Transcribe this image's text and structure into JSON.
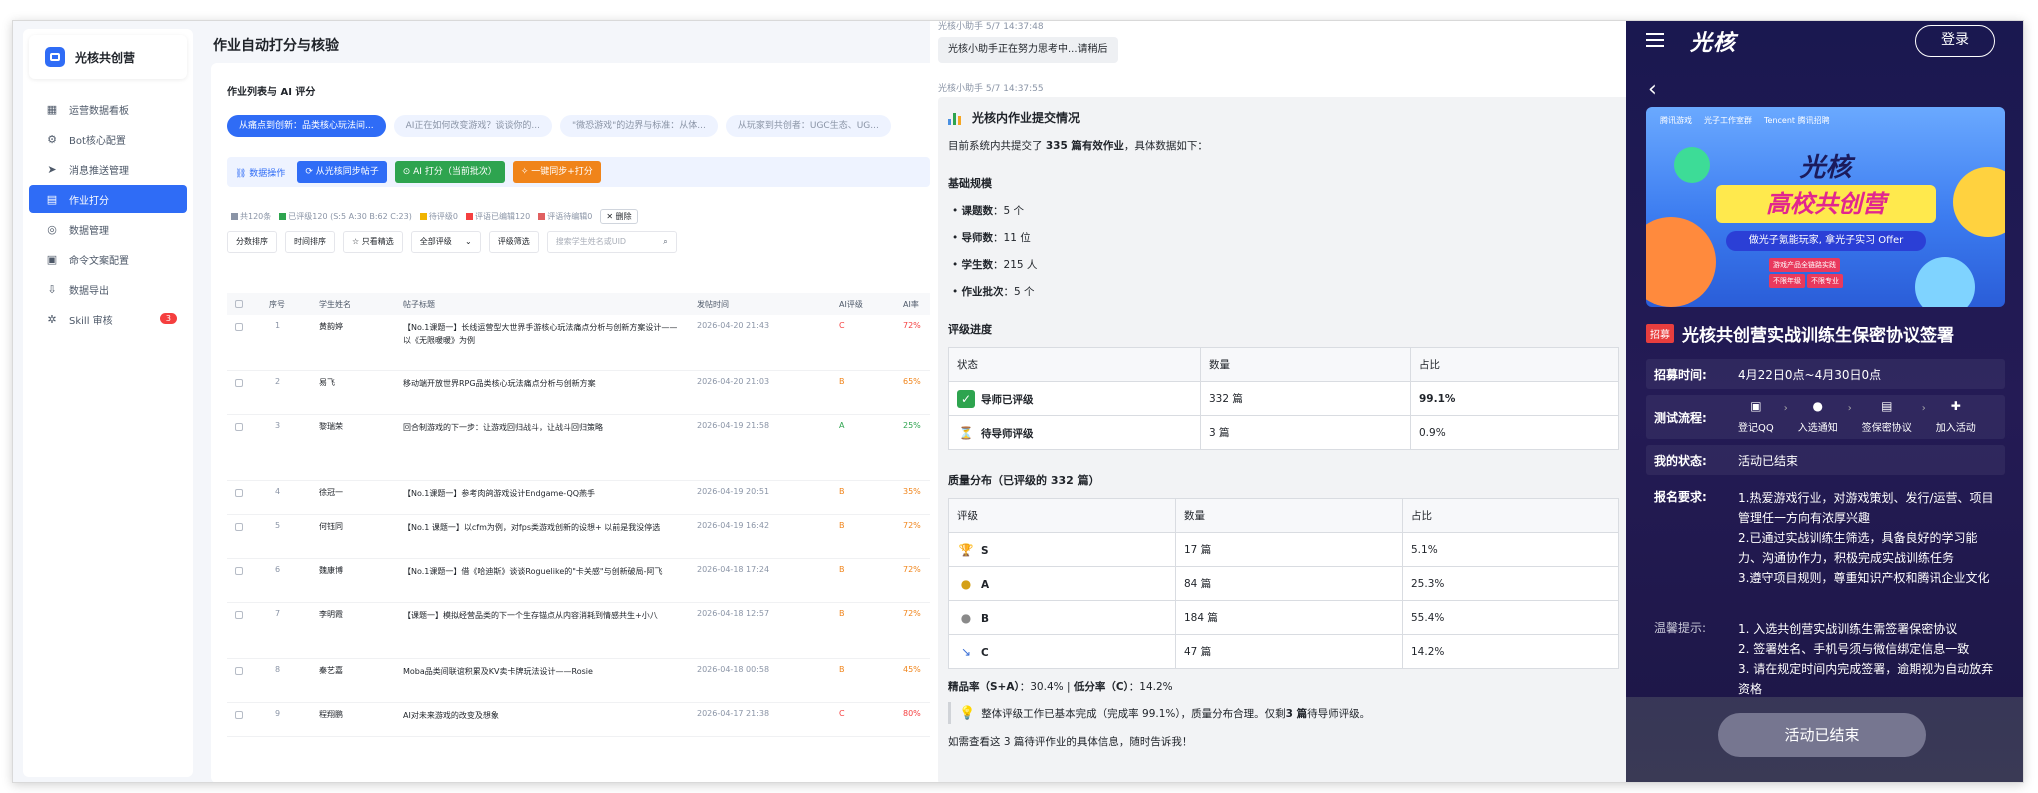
{
  "sidebar": {
    "brand": "光核共创营",
    "items": [
      {
        "label": "运营数据看板",
        "icon": "dashboard-icon"
      },
      {
        "label": "Bot核心配置",
        "icon": "gear-icon"
      },
      {
        "label": "消息推送管理",
        "icon": "send-icon"
      },
      {
        "label": "作业打分",
        "icon": "document-icon",
        "active": true
      },
      {
        "label": "数据管理",
        "icon": "database-icon"
      },
      {
        "label": "命令文案配置",
        "icon": "command-doc-icon"
      },
      {
        "label": "数据导出",
        "icon": "download-icon"
      },
      {
        "label": "Skill 审核",
        "icon": "skill-icon",
        "badge": "3"
      }
    ]
  },
  "main": {
    "page_title": "作业自动打分与核验",
    "card_title": "作业列表与 AI 评分",
    "chips": [
      "从痛点到创新：品类核心玩法间...",
      "AI正在如何改变游戏？谈谈你的...",
      "\"微恐游戏\"的边界与标准：从体...",
      "从玩家到共创者：UGC生态、UG..."
    ],
    "ops": {
      "label": "数据操作",
      "sync": "从光核同步帖子",
      "ai_score": "AI 打分（当前批次）",
      "one_click": "一键同步+打分"
    },
    "stats": {
      "total": "共120条",
      "scored": "已评级120 (S:5 A:30 B:62 C:23)",
      "pending": "待评级0",
      "edited": "评语已编辑120",
      "pending_edit": "评语待编辑0",
      "delete": "删除"
    },
    "filters": {
      "sort_score": "分数排序",
      "sort_time": "时间排序",
      "featured": "只看精选",
      "all_grades": "全部评级",
      "grade_filter": "评级筛选",
      "search_placeholder": "搜索学生姓名或UID"
    },
    "table": {
      "headers": [
        "序号",
        "学生姓名",
        "帖子标题",
        "发帖时间",
        "AI评级",
        "AI率"
      ],
      "rows": [
        {
          "no": "1",
          "name": "黄韵婷",
          "title": "【No.1课题一】长线运营型大世界手游核心玩法痛点分析与创新方案设计——以《无限暖暖》为例",
          "time": "2026-04-20 21:43",
          "grade": "C",
          "rate": "72%"
        },
        {
          "no": "2",
          "name": "易飞",
          "title": "移动端开放世界RPG品类核心玩法痛点分析与创新方案",
          "time": "2026-04-20 21:03",
          "grade": "B",
          "rate": "65%"
        },
        {
          "no": "3",
          "name": "黎瑞荣",
          "title": "回合制游戏的下一步：让游戏回归战斗，让战斗回归策略",
          "time": "2026-04-19 21:58",
          "grade": "A",
          "rate": "25%"
        },
        {
          "no": "4",
          "name": "徐冠一",
          "title": "【No.1课题一】参考肉鸽游戏设计Endgame-QQ燕手",
          "time": "2026-04-19 20:51",
          "grade": "B",
          "rate": "35%"
        },
        {
          "no": "5",
          "name": "何钰同",
          "title": "【No.1 课题一】以cfm为例，对fps类游戏创新的设想+ 以前是我没停选",
          "time": "2026-04-19 16:42",
          "grade": "B",
          "rate": "72%"
        },
        {
          "no": "6",
          "name": "魏康博",
          "title": "【No.1课题一】借《哈迪斯》谈谈Roguelike的\"卡关感\"与创新破局-阿飞",
          "time": "2026-04-18 17:24",
          "grade": "B",
          "rate": "72%"
        },
        {
          "no": "7",
          "name": "李明霞",
          "title": "【课题一】模拟经营品类的下一个生存锚点从内容消耗到情感共生+小八",
          "time": "2026-04-18 12:57",
          "grade": "B",
          "rate": "72%"
        },
        {
          "no": "8",
          "name": "秦艺嘉",
          "title": "Moba品类间联谊积累及KV卖卡牌玩法设计——Rosie",
          "time": "2026-04-18 00:58",
          "grade": "B",
          "rate": "45%"
        },
        {
          "no": "9",
          "name": "程翔鹏",
          "title": "AI对未来游戏的改变及想象",
          "time": "2026-04-17 21:38",
          "grade": "C",
          "rate": "80%"
        }
      ]
    }
  },
  "chat": {
    "msg1_meta": "光核小助手  5/7 14:37:48",
    "msg1_text": "光核小助手正在努力思考中...请稍后",
    "msg2_meta": "光核小助手  5/7 14:37:55",
    "title": "光核内作业提交情况",
    "intro_pre": "目前系统内共提交了 ",
    "intro_bold": "335 篇有效作业",
    "intro_post": "，具体数据如下：",
    "basic_title": "基础规模",
    "basic": [
      {
        "k": "课题数",
        "v": "：5 个"
      },
      {
        "k": "导师数",
        "v": "：11 位"
      },
      {
        "k": "学生数",
        "v": "：215 人"
      },
      {
        "k": "作业批次",
        "v": "：5 个"
      }
    ],
    "progress_title": "评级进度",
    "progress_headers": [
      "状态",
      "数量",
      "占比"
    ],
    "progress_rows": [
      {
        "emoji": "✅",
        "status": "导师已评级",
        "count": "332 篇",
        "pct": "99.1%",
        "bold_pct": true
      },
      {
        "emoji": "⏳",
        "status": "待导师评级",
        "count": "3 篇",
        "pct": "0.9%",
        "bold_pct": false
      }
    ],
    "quality_title": "质量分布（已评级的 332 篇）",
    "quality_headers": [
      "评级",
      "数量",
      "占比"
    ],
    "quality_rows": [
      {
        "emoji": "🏆",
        "grade": "S",
        "count": "17 篇",
        "pct": "5.1%"
      },
      {
        "emoji": "🥇",
        "grade": "A",
        "count": "84 篇",
        "pct": "25.3%"
      },
      {
        "emoji": "🥉",
        "grade": "B",
        "count": "184 篇",
        "pct": "55.4%"
      },
      {
        "emoji": "📉",
        "grade": "C",
        "count": "47 篇",
        "pct": "14.2%"
      }
    ],
    "rate_line_k1": "精品率（S+A）",
    "rate_line_v1": "：30.4% | ",
    "rate_line_k2": "低分率（C）",
    "rate_line_v2": "：14.2%",
    "note_pre": "整体评级工作已基本完成（完成率 99.1%），质量分布合理。仅剩 ",
    "note_bold": "3 篇",
    "note_post": "待导师评级。",
    "closing": "如需查看这 3 篇待评作业的具体信息，随时告诉我！"
  },
  "mobile": {
    "logo": "光核",
    "login": "登录",
    "banner": {
      "logos": [
        "腾讯游戏",
        "光子工作室群",
        "Tencent 腾讯招聘"
      ],
      "title1": "光核",
      "title2": "高校共创营",
      "subtitle": "做光子氪能玩家, 拿光子实习 Offer",
      "tags": [
        "游戏产品全链路实践",
        "不限年级",
        "不限专业"
      ]
    },
    "recruit_tag": "招募",
    "title": "光核共创营实战训练生保密协议签署",
    "time_label": "招募时间:",
    "time_value": "4月22日0点~4月30日0点",
    "flow_label": "测试流程:",
    "steps": [
      "登记QQ",
      "入选通知",
      "签保密协议",
      "加入活动"
    ],
    "status_label": "我的状态:",
    "status_value": "活动已结束",
    "req_label": "报名要求:",
    "req_lines": [
      "1.热爱游戏行业，对游戏策划、发行/运营、项目管理任一方向有浓厚兴趣",
      "2.已通过实战训练生筛选，具备良好的学习能力、沟通协作力，积极完成实战训练任务",
      "3.遵守项目规则，尊重知识产权和腾讯企业文化"
    ],
    "tips_label": "温馨提示:",
    "tips_lines": [
      "1. 入选共创营实战训练生需签署保密协议",
      "2. 签署姓名、手机号须与微信绑定信息一致",
      "3. 请在规定时间内完成签署，逾期视为自动放弃资格"
    ],
    "end_button": "活动已结束"
  }
}
